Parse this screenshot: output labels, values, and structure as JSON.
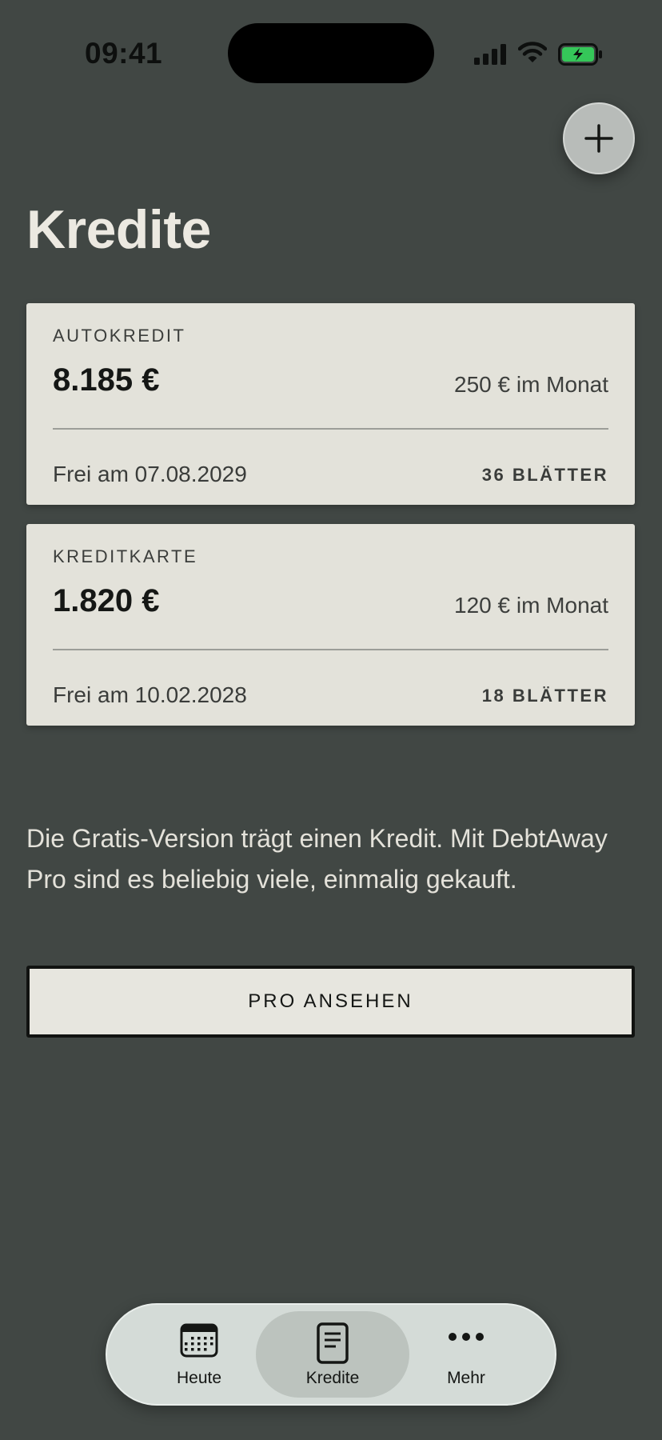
{
  "status_bar": {
    "time": "09:41"
  },
  "header": {
    "title": "Kredite",
    "add_icon": "plus-icon"
  },
  "loans": [
    {
      "name": "AUTOKREDIT",
      "balance": "8.185 €",
      "monthly": "250 € im Monat",
      "payoff": "Frei am 07.08.2029",
      "sheets": "36 BLÄTTER"
    },
    {
      "name": "KREDITKARTE",
      "balance": "1.820 €",
      "monthly": "120 € im Monat",
      "payoff": "Frei am 10.02.2028",
      "sheets": "18 BLÄTTER"
    }
  ],
  "upsell": {
    "text": "Die Gratis-Version trägt einen Kredit. Mit DebtAway Pro sind es beliebig viele, einmalig gekauft.",
    "button_label": "PRO ANSEHEN"
  },
  "tab_bar": {
    "selected": "Kredite",
    "tabs": [
      {
        "label": "Heute",
        "icon": "calendar-icon"
      },
      {
        "label": "Kredite",
        "icon": "document-icon"
      },
      {
        "label": "Mehr",
        "icon": "more-icon"
      }
    ]
  },
  "colors": {
    "background": "#414744",
    "card": "#e3e2da",
    "battery_charge": "#35c759"
  }
}
